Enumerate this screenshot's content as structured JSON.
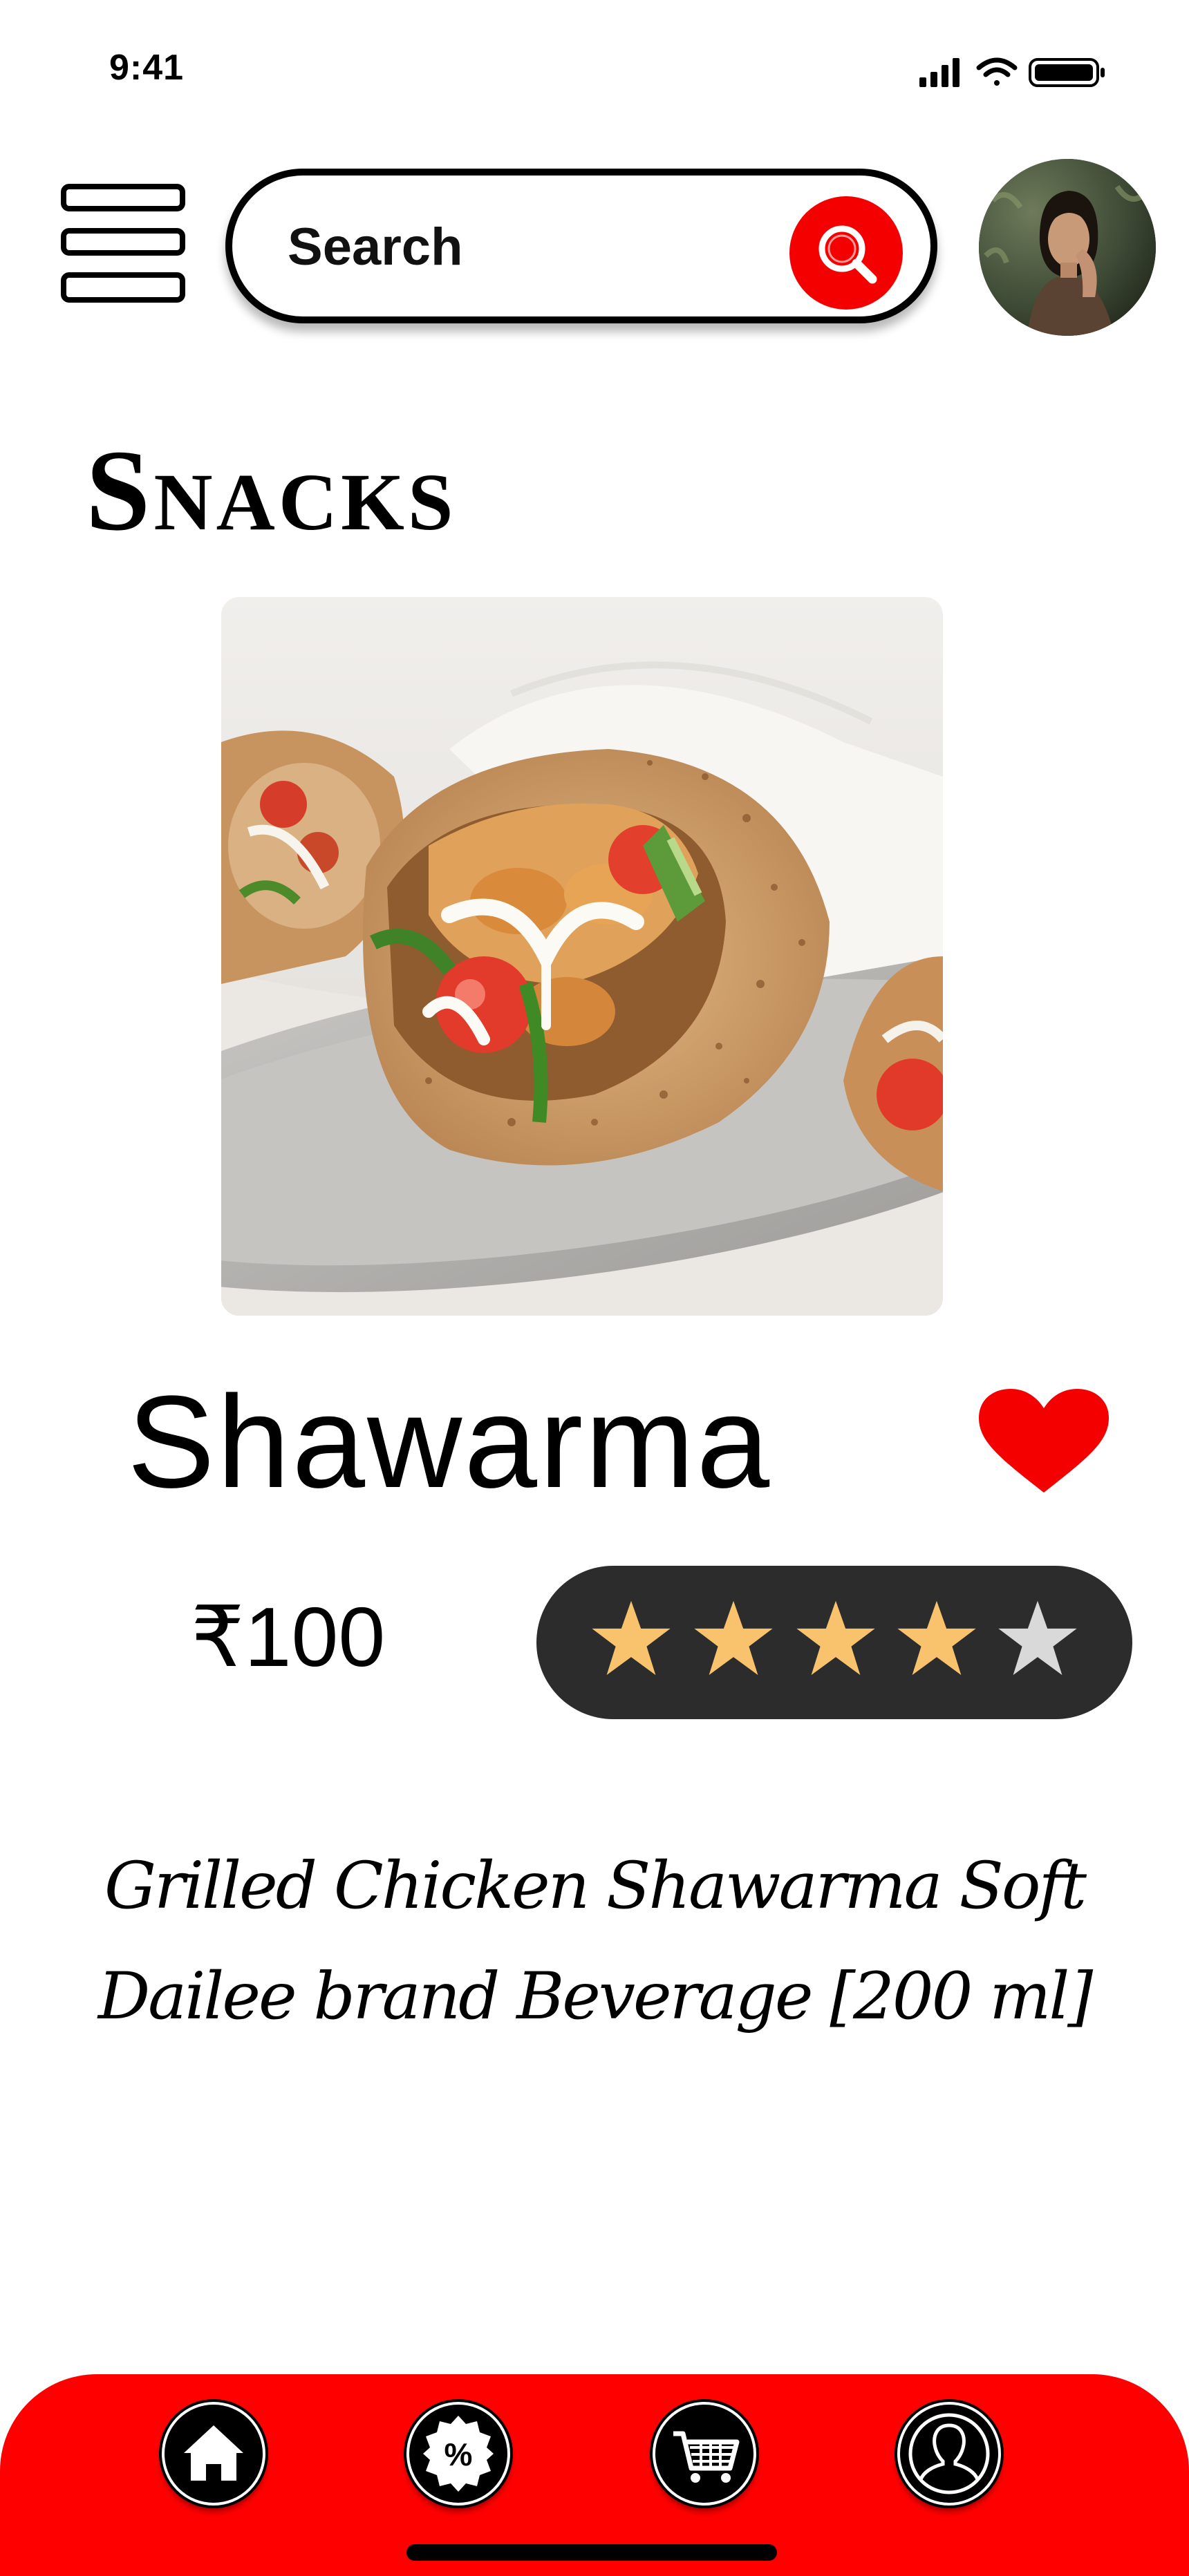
{
  "status_bar": {
    "time": "9:41",
    "icons": [
      "signal-icon",
      "wifi-icon",
      "battery-icon"
    ]
  },
  "header": {
    "menu_icon": "hamburger-menu-icon",
    "search": {
      "placeholder": "Search",
      "icon": "search-icon"
    },
    "avatar_icon": "user-avatar"
  },
  "page": {
    "title": "Snacks"
  },
  "item": {
    "name": "Shawarma",
    "price": "₹100",
    "rating": 4,
    "rating_max": 5,
    "favorite": true,
    "description_lines": [
      "Grilled Chicken Shawarma Soft",
      "Dailee brand Beverage [200 ml]"
    ]
  },
  "bottom_nav": {
    "items": [
      "home-icon",
      "percent-discount-icon",
      "cart-icon",
      "profile-icon"
    ]
  },
  "colors": {
    "accent_red": "#ff0000",
    "star_filled": "#f9c36e",
    "star_empty": "#d9d9d9",
    "rating_bg": "#2c2c2c"
  }
}
